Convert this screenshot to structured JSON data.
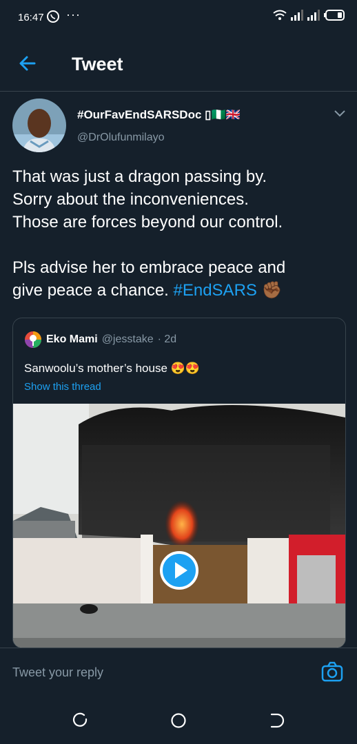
{
  "status_bar": {
    "time": "16:47",
    "more": "···"
  },
  "header": {
    "title": "Tweet"
  },
  "tweet": {
    "display_name": "#OurFavEndSARSDoc ▯🇳🇬🇬🇧",
    "handle": "@DrOlufunmilayo",
    "text": "That was just a dragon passing by.\nSorry about the inconveniences.\nThose are forces beyond our control.\n\nPls advise her to embrace peace and\ngive peace a chance. ",
    "hashtag": "#EndSARS",
    "hashtag_emoji": "✊🏾"
  },
  "quoted_tweet": {
    "display_name": "Eko Mami",
    "handle": "@jesstake",
    "time": "· 2d",
    "text": "Sanwoolu’s mother’s house 😍😍",
    "show_thread": "Show this thread"
  },
  "reply": {
    "placeholder": "Tweet your reply"
  },
  "colors": {
    "background": "#15202b",
    "accent": "#1da1f2",
    "muted": "#8899a6",
    "border": "#38444d"
  },
  "icons": [
    "back-arrow-icon",
    "chevron-down-icon",
    "play-icon",
    "camera-icon",
    "recent-apps-icon",
    "home-icon",
    "back-nav-icon"
  ]
}
